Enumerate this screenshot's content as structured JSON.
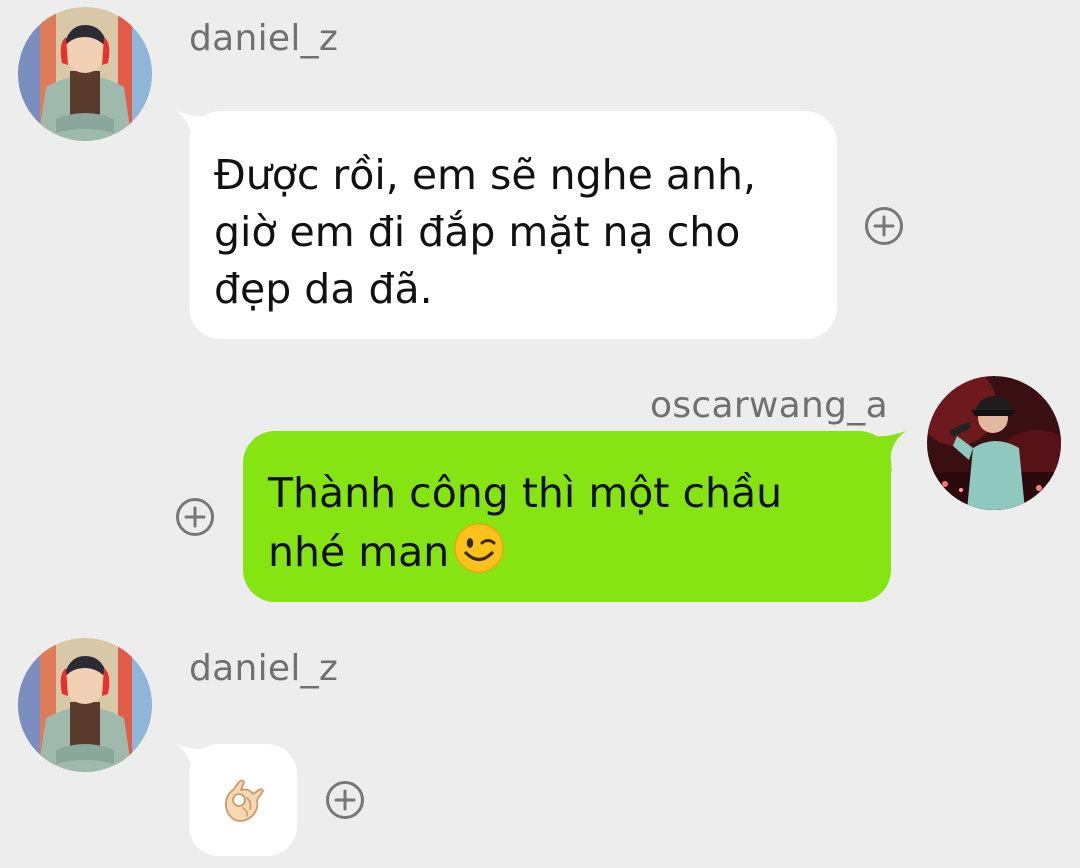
{
  "messages": [
    {
      "sender": "daniel_z",
      "direction": "incoming",
      "text": "Được rồi, em sẽ nghe anh, giờ em đi đắp mặt nạ cho đẹp da đã."
    },
    {
      "sender": "oscarwang_a",
      "direction": "outgoing",
      "text": "Thành công thì một chầu nhé man",
      "emoji": "winking-face"
    },
    {
      "sender": "daniel_z",
      "direction": "incoming",
      "emoji": "ok-hand"
    }
  ],
  "colors": {
    "background": "#ededed",
    "incoming_bubble": "#ffffff",
    "outgoing_bubble": "#85e412",
    "username": "#707070",
    "add_reaction_icon": "#777777"
  },
  "icons": {
    "add_reaction": "plus-circle-icon"
  }
}
